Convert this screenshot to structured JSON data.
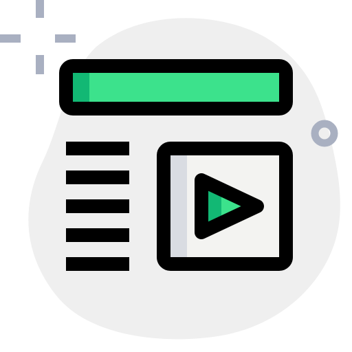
{
  "icon": {
    "name": "video-article-icon",
    "colors": {
      "blob": "#efefef",
      "accent_light": "#3ce28c",
      "accent_dark": "#12b874",
      "stroke": "#000000",
      "panel_fill": "#f3f3f1",
      "panel_shade": "#d9dce2",
      "decor": "#a9b0c1"
    },
    "text_lines": 5
  }
}
